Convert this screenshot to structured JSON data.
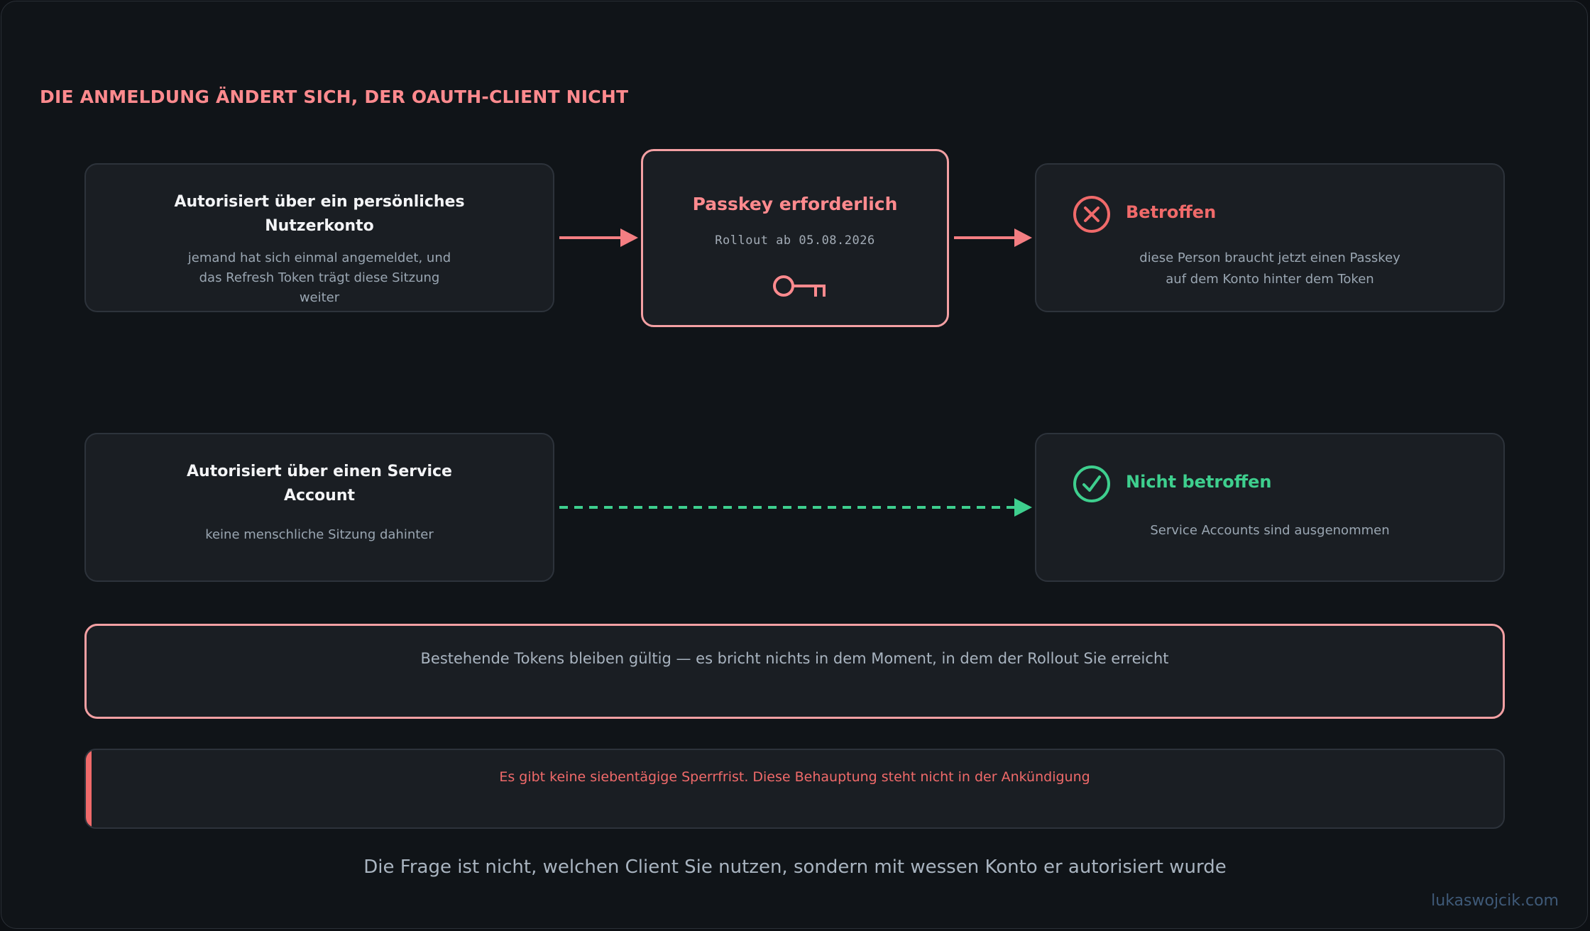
{
  "heading": "DIE ANMELDUNG ÄNDERT SICH, DER OAUTH-CLIENT NICHT",
  "personal": {
    "title_line1": "Autorisiert über ein persönliches",
    "title_line2": "Nutzerkonto",
    "desc_line1": "jemand hat sich einmal angemeldet, und",
    "desc_line2": "das Refresh Token trägt diese Sitzung",
    "desc_line3": "weiter"
  },
  "passkey": {
    "title": "Passkey erforderlich",
    "rollout": "Rollout ab 05.08.2026",
    "icon": "key-icon"
  },
  "affected": {
    "title": "Betroffen",
    "icon": "x-circle-icon",
    "desc_line1": "diese Person braucht jetzt einen Passkey",
    "desc_line2": "auf dem Konto hinter dem Token"
  },
  "service": {
    "title_line1": "Autorisiert über einen Service",
    "title_line2": "Account",
    "desc": "keine menschliche Sitzung dahinter"
  },
  "not_affected": {
    "title": "Nicht betroffen",
    "icon": "check-circle-icon",
    "desc": "Service Accounts sind ausgenommen"
  },
  "note": "Bestehende Tokens bleiben gültig — es bricht nichts in dem Moment, in dem der Rollout Sie erreicht",
  "warning": "Es gibt keine siebentägige Sperrfrist. Diese Behauptung steht nicht in der Ankündigung",
  "footer": "Die Frage ist nicht, welchen Client Sie nutzen, sondern mit wessen Konto er autorisiert wurde",
  "credit": "lukaswojcik.com",
  "colors": {
    "accent_red": "#ff8a8e",
    "status_red": "#f06a6a",
    "status_green": "#3ecf8e",
    "card_bg": "#1a1e23",
    "page_bg": "#101418"
  }
}
